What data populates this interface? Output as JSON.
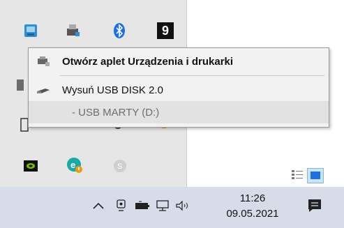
{
  "tray": {
    "icons": [
      "network-card-icon",
      "printer-icon",
      "bluetooth-icon",
      "number-9-icon",
      "device-icon",
      "usb-drive-icon",
      "gear-icon",
      "speaker-icon",
      "nvidia-icon",
      "eset-icon",
      "skype-icon"
    ],
    "badge_9": "9"
  },
  "menu": {
    "items": [
      {
        "label": "Otwórz aplet Urządzenia i drukarki",
        "bold": true
      },
      {
        "label": "Wysuń USB DISK 2.0",
        "bold": false
      },
      {
        "label": "- USB MARTY (D:)",
        "bold": false,
        "disabled": true
      }
    ]
  },
  "taskbar": {
    "time": "11:26",
    "date": "09.05.2021",
    "icons": [
      "chevron-up-icon",
      "meet-now-icon",
      "battery-icon",
      "network-icon",
      "volume-icon",
      "notifications-icon"
    ]
  },
  "colors": {
    "taskbar": "#d6dce8",
    "menu_bg": "#f2f2f2",
    "tray_bg": "#e6e6e6"
  }
}
